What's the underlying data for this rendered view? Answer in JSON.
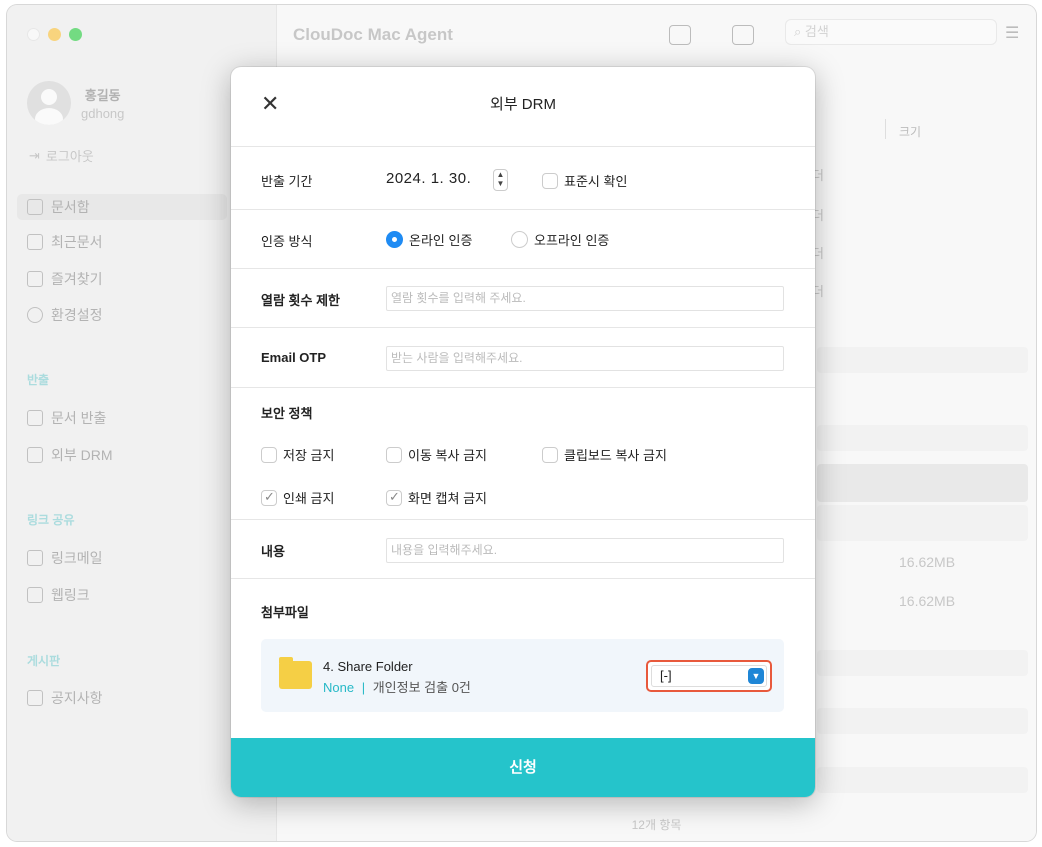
{
  "window": {
    "app_title": "ClouDoc Mac Agent",
    "search_placeholder": "검색",
    "footer_count": "12개 항목"
  },
  "sidebar": {
    "user_name": "홍길동",
    "user_id": "gdhong",
    "logout": "로그아웃",
    "items": [
      {
        "label": "문서함",
        "icon": "document-box-icon"
      },
      {
        "label": "최근문서",
        "icon": "recent-doc-icon"
      },
      {
        "label": "즐겨찾기",
        "icon": "favorite-doc-icon"
      },
      {
        "label": "환경설정",
        "icon": "gear-icon"
      }
    ],
    "sections": {
      "export": {
        "title": "반출",
        "items": [
          "문서 반출",
          "외부 DRM"
        ]
      },
      "link": {
        "title": "링크 공유",
        "items": [
          "링크메일",
          "웹링크"
        ]
      },
      "board": {
        "title": "게시판",
        "items": [
          "공지사항"
        ]
      }
    }
  },
  "list": {
    "size_header": "크기",
    "partial_text": "더",
    "sizes": [
      "16.62MB",
      "16.62MB"
    ]
  },
  "modal": {
    "title": "외부 DRM",
    "export_period_label": "반출 기간",
    "export_period_value": "2024.  1. 30.",
    "standard_time_label": "표준시 확인",
    "auth_method_label": "인증 방식",
    "auth_online": "온라인 인증",
    "auth_offline": "오프라인 인증",
    "view_limit_label": "열람 횟수 제한",
    "view_limit_placeholder": "열람 횟수를 입력해 주세요.",
    "email_otp_label": "Email OTP",
    "email_otp_placeholder": "받는 사람을 입력해주세요.",
    "security_policy_label": "보안 정책",
    "policies": [
      {
        "label": "저장 금지",
        "checked": false
      },
      {
        "label": "이동 복사 금지",
        "checked": false
      },
      {
        "label": "클립보드 복사 금지",
        "checked": false
      },
      {
        "label": "인쇄 금지",
        "checked": true
      },
      {
        "label": "화면 캡쳐 금지",
        "checked": true
      }
    ],
    "content_label": "내용",
    "content_placeholder": "내용을 입력해주세요.",
    "attachment_label": "첨부파일",
    "attachment": {
      "name": "4. Share Folder",
      "status": "None",
      "separator": "|",
      "privacy": "개인정보 검출 0건",
      "select_value": "[-]"
    },
    "submit_label": "신청"
  },
  "colors": {
    "accent": "#25c4cb",
    "radio_on": "#1f8bf3",
    "highlight": "#e8593c",
    "folder": "#f5cf45"
  }
}
